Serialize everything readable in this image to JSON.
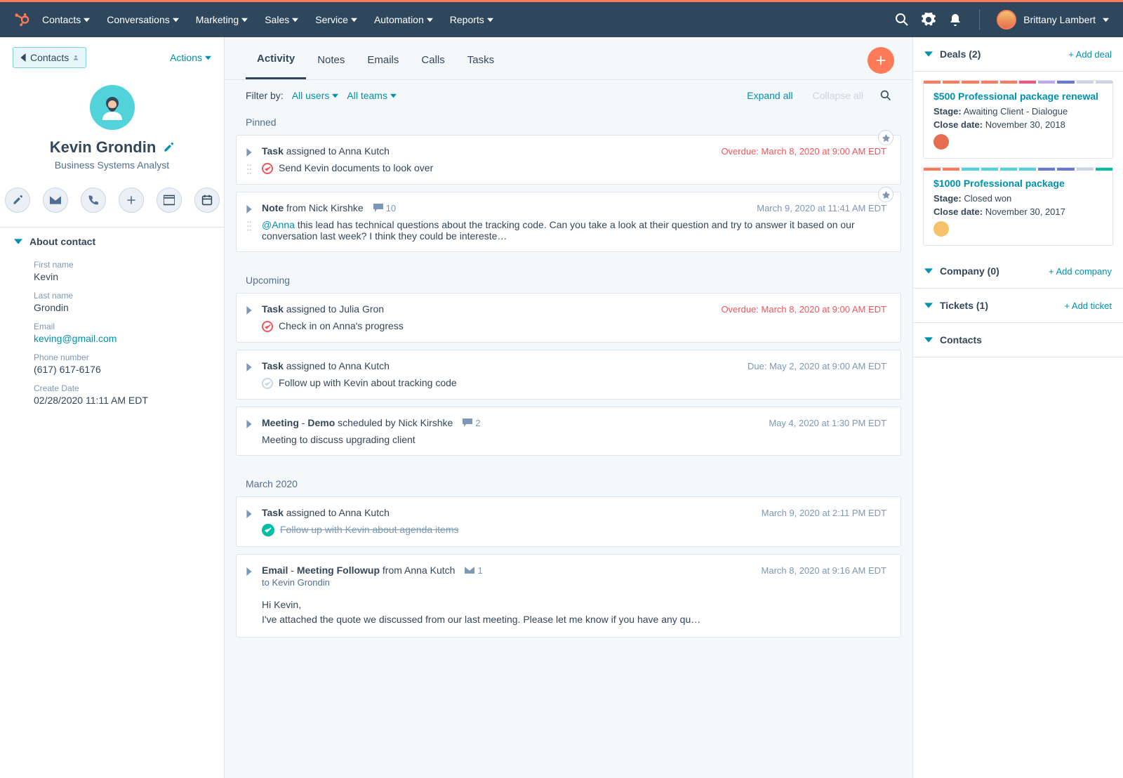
{
  "nav": {
    "items": [
      "Contacts",
      "Conversations",
      "Marketing",
      "Sales",
      "Service",
      "Automation",
      "Reports"
    ],
    "user_name": "Brittany Lambert"
  },
  "left": {
    "back_label": "Contacts",
    "actions_label": "Actions",
    "profile": {
      "name": "Kevin Grondin",
      "title": "Business Systems Analyst"
    },
    "about_title": "About contact",
    "fields": [
      {
        "label": "First name",
        "value": "Kevin"
      },
      {
        "label": "Last name",
        "value": "Grondin"
      },
      {
        "label": "Email",
        "value": "keving@gmail.com",
        "link": true
      },
      {
        "label": "Phone number",
        "value": "(617) 617-6176"
      },
      {
        "label": "Create Date",
        "value": "02/28/2020 11:11 AM EDT"
      }
    ]
  },
  "tabs": [
    "Activity",
    "Notes",
    "Emails",
    "Calls",
    "Tasks"
  ],
  "active_tab": "Activity",
  "filter": {
    "label": "Filter by:",
    "users": "All users",
    "teams": "All teams",
    "expand": "Expand all",
    "collapse": "Collapse all"
  },
  "sections": {
    "pinned": "Pinned",
    "upcoming": "Upcoming",
    "march": "March 2020"
  },
  "pinned": [
    {
      "type_label": "Task",
      "middle": " assigned to ",
      "person": "Anna Kutch",
      "meta": "Overdue: March 8, 2020 at 9:00 AM EDT",
      "overdue": true,
      "check": "open",
      "body": "Send Kevin documents to look over"
    },
    {
      "type_label": "Note",
      "middle": " from ",
      "person": "Nick Kirshke",
      "comments": "10",
      "meta": "March 9, 2020 at 11:41 AM EDT",
      "mention": "@Anna",
      "body": " this lead has technical questions about the tracking code. Can you take a look at their question and try to answer it based on our conversation last week? I think they could be intereste…"
    }
  ],
  "upcoming": [
    {
      "type_label": "Task",
      "middle": " assigned to ",
      "person": "Julia Gron",
      "meta": "Overdue: March 8, 2020 at 9:00 AM EDT",
      "overdue": true,
      "check": "open",
      "body": "Check in on Anna's progress"
    },
    {
      "type_label": "Task",
      "middle": " assigned to ",
      "person": "Anna Kutch",
      "meta": "Due: May 2, 2020 at 9:00 AM EDT",
      "check": "gray",
      "body": "Follow up with Kevin about tracking code"
    },
    {
      "type_label": "Meeting",
      "dash": " - ",
      "subtype": "Demo",
      "middle": " scheduled by ",
      "person": "Nick Kirshke",
      "comments": "2",
      "meta": "May 4, 2020 at 1:30 PM EDT",
      "body": "Meeting to discuss upgrading client"
    }
  ],
  "march": [
    {
      "type_label": "Task",
      "middle": " assigned to ",
      "person": "Anna Kutch",
      "meta": "March 9, 2020 at 2:11 PM EDT",
      "check": "done",
      "body": "Follow up with Kevin about agenda items",
      "strike": true
    },
    {
      "type_label": "Email",
      "dash": " - ",
      "subtype": "Meeting Followup",
      "middle": " from ",
      "person": "Anna Kutch",
      "email_count": "1",
      "meta": "March 8, 2020 at 9:16 AM EDT",
      "to": "to Kevin Grondin",
      "greeting": "Hi Kevin,",
      "body": "I've attached the quote we discussed from our last meeting. Please let me know if you have any qu…"
    }
  ],
  "right": {
    "deals": {
      "title": "Deals (2)",
      "add": "+ Add deal",
      "items": [
        {
          "name": "$500 Professional package renewal",
          "stage_label": "Stage:",
          "stage": "Awaiting Client - Dialogue",
          "close_label": "Close date:",
          "close": "November 30, 2018",
          "avatar_color": "#e66e50",
          "stripes": [
            "#ff7a59",
            "#ff7a59",
            "#ff7a59",
            "#ff7a59",
            "#ff7a59",
            "#f2547d",
            "#c a",
            "#6a78d1",
            "#cbd6e2",
            "#cbd6e2"
          ]
        },
        {
          "name": "$1000 Professional package",
          "stage_label": "Stage:",
          "stage": "Closed won",
          "close_label": "Close date:",
          "close": "November 30, 2017",
          "avatar_color": "#f5c26b"
        }
      ]
    },
    "panels": [
      {
        "title": "Company (0)",
        "add": "+ Add company"
      },
      {
        "title": "Tickets (1)",
        "add": "+ Add ticket"
      },
      {
        "title": "Contacts",
        "add": ""
      }
    ]
  }
}
